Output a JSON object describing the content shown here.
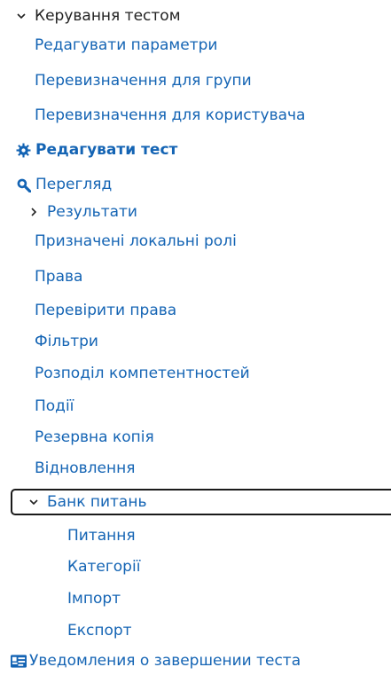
{
  "tree": {
    "test_management": "Керування тестом",
    "edit_settings": "Редагувати параметри",
    "group_overrides": "Перевизначення для групи",
    "user_overrides": "Перевизначення для користувача",
    "edit_test": "Редагувати тест",
    "preview": "Перегляд",
    "results": "Результати",
    "local_roles": "Призначені локальні ролі",
    "permissions": "Права",
    "check_permissions": "Перевірити права",
    "filters": "Фільтри",
    "competency": "Розподіл компетентностей",
    "events": "Події",
    "backup": "Резервна копія",
    "restore": "Відновлення",
    "question_bank": "Банк питань",
    "questions": "Питання",
    "categories": "Категорії",
    "import": "Імпорт",
    "export": "Експорт",
    "completion_notice": "Уведомления о завершении теста"
  },
  "icons": {
    "expanded": "chevron-down-icon",
    "collapsed": "chevron-right-icon",
    "edit_test": "gear-icon",
    "preview": "magnify-icon",
    "completion_notice": "card-icon"
  },
  "colors": {
    "link": "#1464b4",
    "text": "#222222",
    "icon_blue": "#1464b4"
  }
}
